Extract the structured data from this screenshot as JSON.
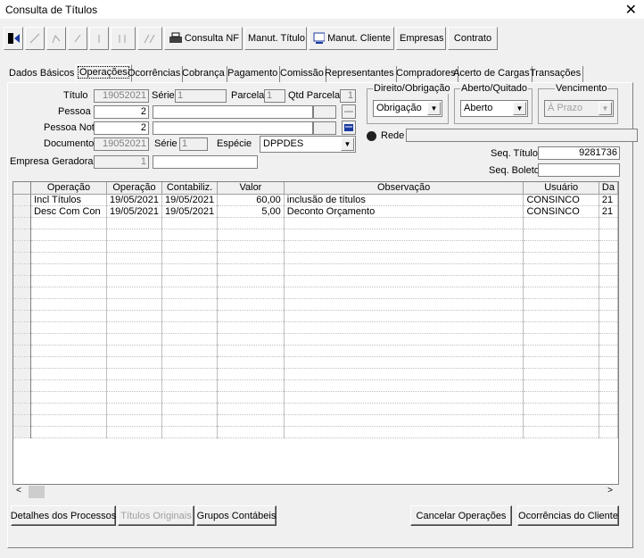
{
  "window": {
    "title": "Consulta de Títulos",
    "close": "✕"
  },
  "toolbar": {
    "consulta_nf": "Consulta NF",
    "manut_titulo": "Manut. Título",
    "manut_cliente": "Manut. Cliente",
    "empresas": "Empresas",
    "contrato": "Contrato"
  },
  "tabs": [
    "Dados Básicos",
    "Operações",
    "Ocorrências",
    "Cobrança",
    "Pagamento",
    "Comissão",
    "Representantes",
    "Compradores",
    "Acerto de Cargas",
    "Transações"
  ],
  "form": {
    "titulo_label": "Título",
    "titulo": "19052021",
    "serie_label": "Série",
    "serie": "1",
    "parcela_label": "Parcela",
    "parcela": "1",
    "qtd_parcela_label": "Qtd Parcela",
    "qtd_parcela": "1",
    "pessoa_label": "Pessoa",
    "pessoa": "2",
    "pessoa_nota_label": "Pessoa Nota",
    "pessoa_nota": "2",
    "documento_label": "Documento",
    "documento": "19052021",
    "serie2_label": "Série",
    "serie2": "1",
    "especie_label": "Espécie",
    "especie": "DPPDES",
    "empresa_label": "Empresa Geradora",
    "empresa": "1",
    "direito_label": "Direito/Obrigação",
    "direito": "Obrigação",
    "aberto_label": "Aberto/Quitado",
    "aberto": "Aberto",
    "vencimento_label": "Vencimento",
    "vencimento": "À Prazo",
    "rede_label": "Rede",
    "seq_titulo_label": "Seq. Título",
    "seq_titulo": "9281736",
    "seq_boleto_label": "Seq. Boleto",
    "seq_boleto": ""
  },
  "grid": {
    "columns": [
      "Operação",
      "Operação",
      "Contabiliz.",
      "Valor",
      "Observação",
      "Usuário",
      "Da"
    ],
    "rows": [
      [
        "Incl Títulos",
        "19/05/2021",
        "19/05/2021",
        "60,00",
        "inclusão de títulos",
        "CONSINCO",
        "21"
      ],
      [
        "Desc Com Con",
        "19/05/2021",
        "19/05/2021",
        "5,00",
        "Deconto Orçamento",
        "CONSINCO",
        "21"
      ]
    ]
  },
  "buttons": {
    "detalhes": "Detalhes dos Processos",
    "titulos_originais": "Títulos Originais",
    "grupos": "Grupos Contábeis",
    "cancelar": "Cancelar Operações",
    "ocorrencias": "Ocorrências do Cliente"
  }
}
